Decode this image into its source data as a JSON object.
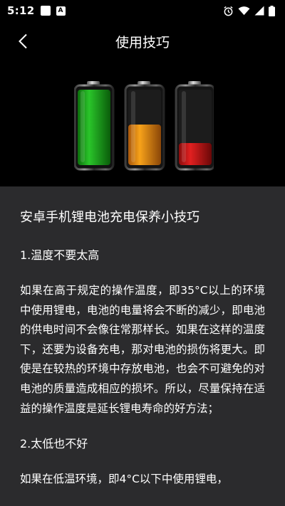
{
  "status_bar": {
    "time": "5:12",
    "left_icons": [
      "square-notification-icon",
      "a-notification-icon"
    ],
    "right_icons": [
      "alarm-icon",
      "wifi-icon",
      "signal-icon",
      "battery-icon"
    ]
  },
  "header": {
    "title": "使用技巧",
    "back_icon": "chevron-left-icon"
  },
  "banner": {
    "image": "three-batteries-image",
    "battery_levels": [
      1.0,
      0.5,
      0.28
    ],
    "battery_colors": [
      "#1ea61e",
      "#e88a10",
      "#d41818"
    ]
  },
  "article": {
    "title": "安卓手机锂电池充电保养小技巧",
    "sections": [
      {
        "heading": "1.温度不要太高",
        "paragraph": "如果在高于规定的操作温度，即35°C以上的环境中使用锂电，电池的电量将会不断的减少，即电池的供电时间不会像往常那样长。如果在这样的温度下，还要为设备充电，那对电池的损伤将更大。即使是在较热的环境中存放电池，也会不可避免的对电池的质量造成相应的损坏。所以，尽量保持在适益的操作温度是延长锂电寿命的好方法；"
      },
      {
        "heading": "2.太低也不好",
        "paragraph": "如果在低温环境，即4°C以下中使用锂电，"
      }
    ]
  }
}
